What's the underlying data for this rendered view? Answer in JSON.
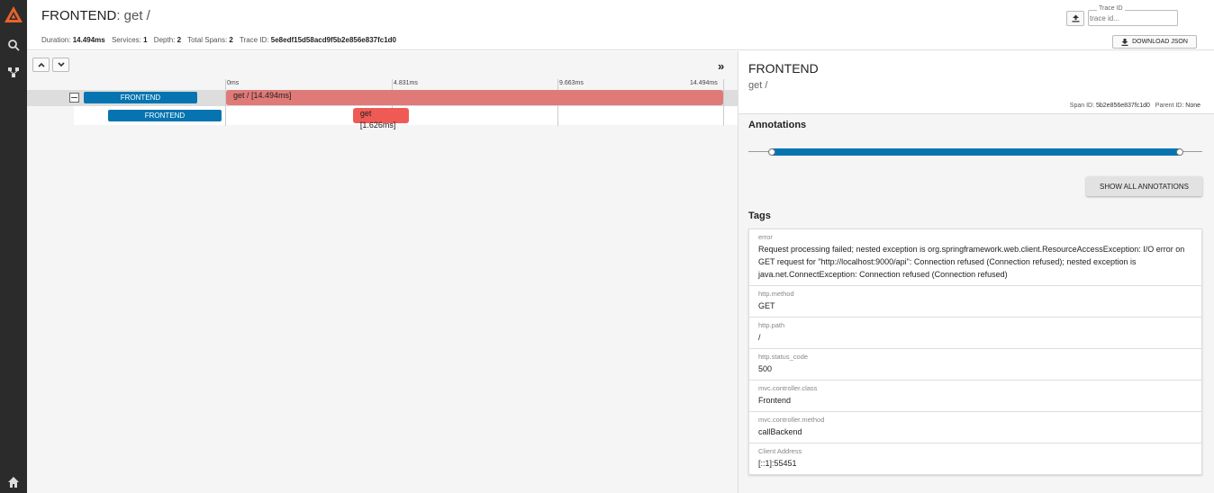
{
  "header": {
    "service": "FRONTEND",
    "operation": ": get /",
    "stats": [
      {
        "label": "Duration:",
        "value": "14.494ms"
      },
      {
        "label": "Services:",
        "value": "1"
      },
      {
        "label": "Depth:",
        "value": "2"
      },
      {
        "label": "Total Spans:",
        "value": "2"
      },
      {
        "label": "Trace ID:",
        "value": "5e8edf15d58acd9f5b2e856e837fc1d0"
      }
    ],
    "trace_id_label": "Trace ID",
    "trace_id_placeholder": "trace id...",
    "download_label": "DOWNLOAD JSON"
  },
  "timeline": {
    "ticks": [
      "0ms",
      "4.831ms",
      "9.663ms",
      "14.494ms"
    ],
    "spans": [
      {
        "service": "FRONTEND",
        "label": "get / [14.494ms]",
        "start_ms": 0,
        "duration_ms": 14.494,
        "depth": 0,
        "color": "#e07a78"
      },
      {
        "service": "FRONTEND",
        "label": "get [1.626ms]",
        "start_ms": 3.7,
        "duration_ms": 1.626,
        "depth": 1,
        "color": "#f05a55"
      }
    ]
  },
  "detail": {
    "service": "FRONTEND",
    "operation": "get /",
    "span_id_label": "Span ID:",
    "span_id": "5b2e856e837fc1d0",
    "parent_id_label": "Parent ID:",
    "parent_id": "None",
    "annotations_title": "Annotations",
    "show_all_label": "SHOW ALL ANNOTATIONS",
    "tags_title": "Tags",
    "tags": [
      {
        "key": "error",
        "value": "Request processing failed; nested exception is org.springframework.web.client.ResourceAccessException: I/O error on GET request for \"http://localhost:9000/api\": Connection refused (Connection refused); nested exception is java.net.ConnectException: Connection refused (Connection refused)"
      },
      {
        "key": "http.method",
        "value": "GET"
      },
      {
        "key": "http.path",
        "value": "/"
      },
      {
        "key": "http.status_code",
        "value": "500"
      },
      {
        "key": "mvc.controller.class",
        "value": "Frontend"
      },
      {
        "key": "mvc.controller.method",
        "value": "callBackend"
      },
      {
        "key": "Client Address",
        "value": "[::1]:55451"
      }
    ]
  },
  "colors": {
    "accent": "#0574b0",
    "sidebar": "#2b2b2b",
    "error_span": "#e07a78"
  }
}
